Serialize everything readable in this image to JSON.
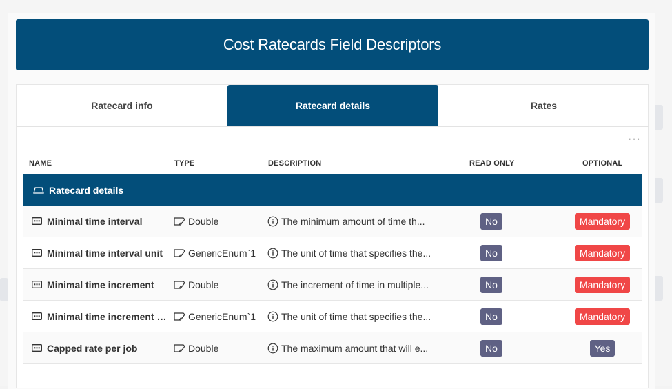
{
  "header": {
    "title": "Cost Ratecards Field Descriptors"
  },
  "tabs": [
    {
      "label": "Ratecard info",
      "active": false
    },
    {
      "label": "Ratecard details",
      "active": true
    },
    {
      "label": "Rates",
      "active": false
    }
  ],
  "more_menu": "···",
  "columns": {
    "name": "NAME",
    "type": "TYPE",
    "description": "DESCRIPTION",
    "read_only": "READ ONLY",
    "optional": "OPTIONAL"
  },
  "group": {
    "label": "Ratecard details",
    "icon": "group-icon"
  },
  "rows": [
    {
      "name": "Minimal time interval",
      "type": "Double",
      "description": "The minimum amount of time th...",
      "read_only": "No",
      "optional": "Mandatory"
    },
    {
      "name": "Minimal time interval unit",
      "type": "GenericEnum`1",
      "description": "The unit of time that specifies the...",
      "read_only": "No",
      "optional": "Mandatory"
    },
    {
      "name": "Minimal time increment",
      "type": "Double",
      "description": "The increment of time in multiple...",
      "read_only": "No",
      "optional": "Mandatory"
    },
    {
      "name": "Minimal time increment u...",
      "type": "GenericEnum`1",
      "description": "The unit of time that specifies the...",
      "read_only": "No",
      "optional": "Mandatory"
    },
    {
      "name": "Capped rate per job",
      "type": "Double",
      "description": "The maximum amount that will e...",
      "read_only": "No",
      "optional": "Yes"
    }
  ],
  "colors": {
    "primary": "#034e7a",
    "badge_no": "#5f6184",
    "badge_mandatory": "#f04747"
  }
}
